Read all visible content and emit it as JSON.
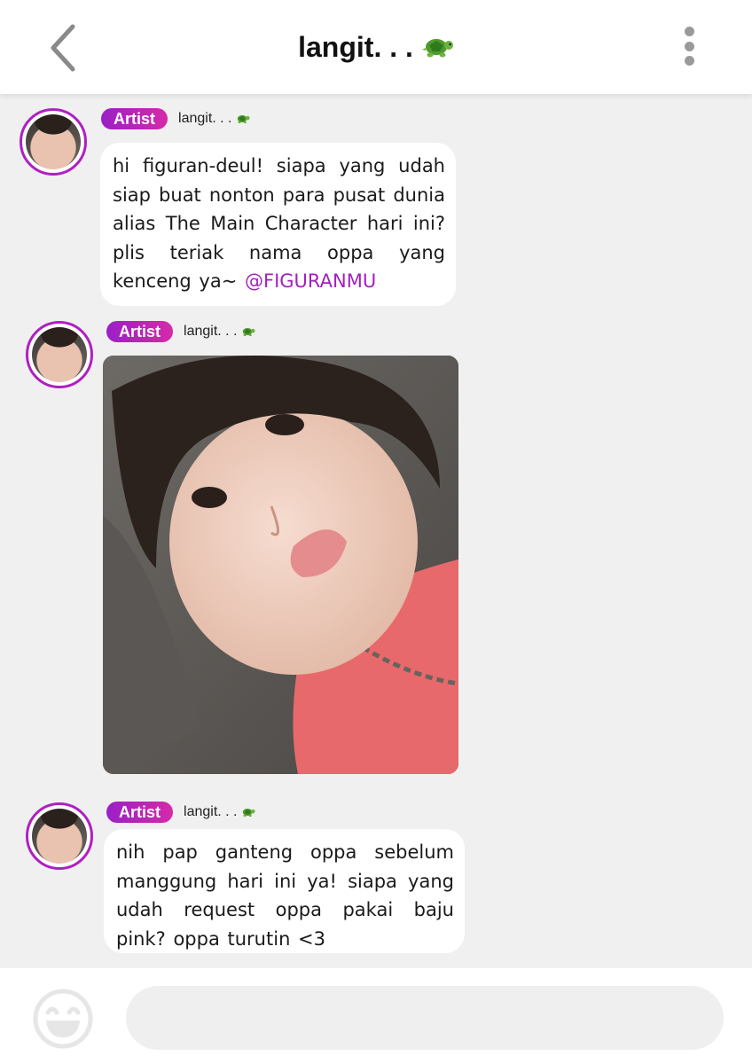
{
  "header": {
    "title": "langit. . .",
    "title_icon": "turtle-icon"
  },
  "messages": [
    {
      "badge": "Artist",
      "sender": "langit. . .",
      "text": "hi figuran-deul! siapa yang udah siap buat nonton para pusat dunia alias The Main Character hari ini? plis teriak nama oppa yang kenceng ya~",
      "mention": "@FIGURANMU"
    },
    {
      "badge": "Artist",
      "sender": "langit. . .",
      "photo": "selfie photo"
    },
    {
      "badge": "Artist",
      "sender": "langit. . .",
      "text": "nih pap ganteng oppa sebelum manggung hari ini ya! siapa yang udah request oppa pakai baju pink? oppa turutin <3"
    }
  ],
  "composer": {
    "placeholder": "",
    "emoji_icon": "smiley-icon"
  },
  "colors": {
    "accent": "#a321bf",
    "badge_start": "#9b1fc7",
    "badge_end": "#d62aa8",
    "background": "#f0f0f0",
    "bubble": "#ffffff"
  }
}
